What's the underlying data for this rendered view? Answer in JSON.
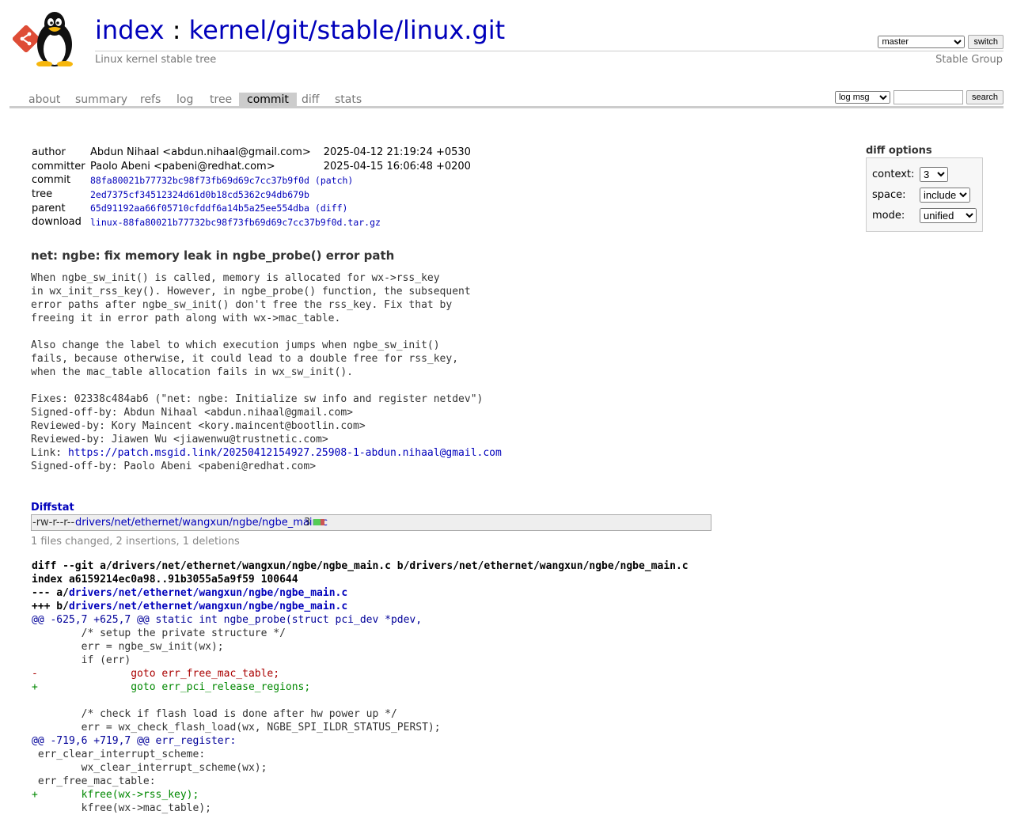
{
  "header": {
    "title_index": "index",
    "title_sep": " : ",
    "title_repo": "kernel/git/stable/linux.git",
    "subtitle": "Linux kernel stable tree",
    "owner": "Stable Group",
    "branch_selected": "master",
    "switch_label": "switch"
  },
  "tabs": [
    {
      "label": "about"
    },
    {
      "label": "summary"
    },
    {
      "label": "refs"
    },
    {
      "label": "log"
    },
    {
      "label": "tree"
    },
    {
      "label": "commit"
    },
    {
      "label": "diff"
    },
    {
      "label": "stats"
    }
  ],
  "active_tab": "commit",
  "search": {
    "type_selected": "log msg",
    "query": "",
    "button_label": "search"
  },
  "commit_info": {
    "author_label": "author",
    "author": "Abdun Nihaal <abdun.nihaal@gmail.com>",
    "author_date": "2025-04-12 21:19:24 +0530",
    "committer_label": "committer",
    "committer": "Paolo Abeni <pabeni@redhat.com>",
    "committer_date": "2025-04-15 16:06:48 +0200",
    "commit_label": "commit",
    "commit_hash": "88fa80021b77732bc98f73fb69d69c7cc37b9f0d",
    "commit_patch": "(patch)",
    "tree_label": "tree",
    "tree_hash": "2ed7375cf34512324d61d0b18cd5362c94db679b",
    "parent_label": "parent",
    "parent_hash": "65d91192aa66f05710cfddf6a14b5a25ee554dba",
    "parent_diff": "(diff)",
    "download_label": "download",
    "download_file": "linux-88fa80021b77732bc98f73fb69d69c7cc37b9f0d.tar.gz"
  },
  "diff_options": {
    "header": "diff options",
    "context_label": "context:",
    "context_value": "3",
    "space_label": "space:",
    "space_value": "include",
    "mode_label": "mode:",
    "mode_value": "unified"
  },
  "message": {
    "subject": "net: ngbe: fix memory leak in ngbe_probe() error path",
    "body_before_link": "When ngbe_sw_init() is called, memory is allocated for wx->rss_key\nin wx_init_rss_key(). However, in ngbe_probe() function, the subsequent\nerror paths after ngbe_sw_init() don't free the rss_key. Fix that by\nfreeing it in error path along with wx->mac_table.\n\nAlso change the label to which execution jumps when ngbe_sw_init()\nfails, because otherwise, it could lead to a double free for rss_key,\nwhen the mac_table allocation fails in wx_sw_init().\n\nFixes: 02338c484ab6 (\"net: ngbe: Initialize sw info and register netdev\")\nSigned-off-by: Abdun Nihaal <abdun.nihaal@gmail.com>\nReviewed-by: Kory Maincent <kory.maincent@bootlin.com>\nReviewed-by: Jiawen Wu <jiawenwu@trustnetic.com>\nLink: ",
    "link": "https://patch.msgid.link/20250412154927.25908-1-abdun.nihaal@gmail.com",
    "body_after_link": "\nSigned-off-by: Paolo Abeni <pabeni@redhat.com>"
  },
  "diffstat": {
    "header": "Diffstat",
    "mode": "-rw-r--r--",
    "file": "drivers/net/ethernet/wangxun/ngbe/ngbe_main.c",
    "changes": "3",
    "insertions_fraction": 0.67,
    "summary": "1 files changed, 2 insertions, 1 deletions"
  },
  "diff": {
    "head_line": "diff --git a/drivers/net/ethernet/wangxun/ngbe/ngbe_main.c b/drivers/net/ethernet/wangxun/ngbe/ngbe_main.c",
    "index_line": "index a6159214ec0a98..91b3055a5a9f59 100644",
    "from_prefix": "--- a/",
    "to_prefix": "+++ b/",
    "file": "drivers/net/ethernet/wangxun/ngbe/ngbe_main.c",
    "lines": [
      {
        "t": "hunk",
        "text": "@@ -625,7 +625,7 @@ static int ngbe_probe(struct pci_dev *pdev,"
      },
      {
        "t": "ctx",
        "text": " \t/* setup the private structure */"
      },
      {
        "t": "ctx",
        "text": " \terr = ngbe_sw_init(wx);"
      },
      {
        "t": "ctx",
        "text": " \tif (err)"
      },
      {
        "t": "del",
        "text": "-\t\tgoto err_free_mac_table;"
      },
      {
        "t": "add",
        "text": "+\t\tgoto err_pci_release_regions;"
      },
      {
        "t": "ctx",
        "text": " "
      },
      {
        "t": "ctx",
        "text": " \t/* check if flash load is done after hw power up */"
      },
      {
        "t": "ctx",
        "text": " \terr = wx_check_flash_load(wx, NGBE_SPI_ILDR_STATUS_PERST);"
      },
      {
        "t": "hunk",
        "text": "@@ -719,6 +719,7 @@ err_register:"
      },
      {
        "t": "ctx",
        "text": " err_clear_interrupt_scheme:"
      },
      {
        "t": "ctx",
        "text": " \twx_clear_interrupt_scheme(wx);"
      },
      {
        "t": "ctx",
        "text": " err_free_mac_table:"
      },
      {
        "t": "add",
        "text": "+\tkfree(wx->rss_key);"
      },
      {
        "t": "ctx",
        "text": " \tkfree(wx->mac_table);"
      }
    ]
  }
}
